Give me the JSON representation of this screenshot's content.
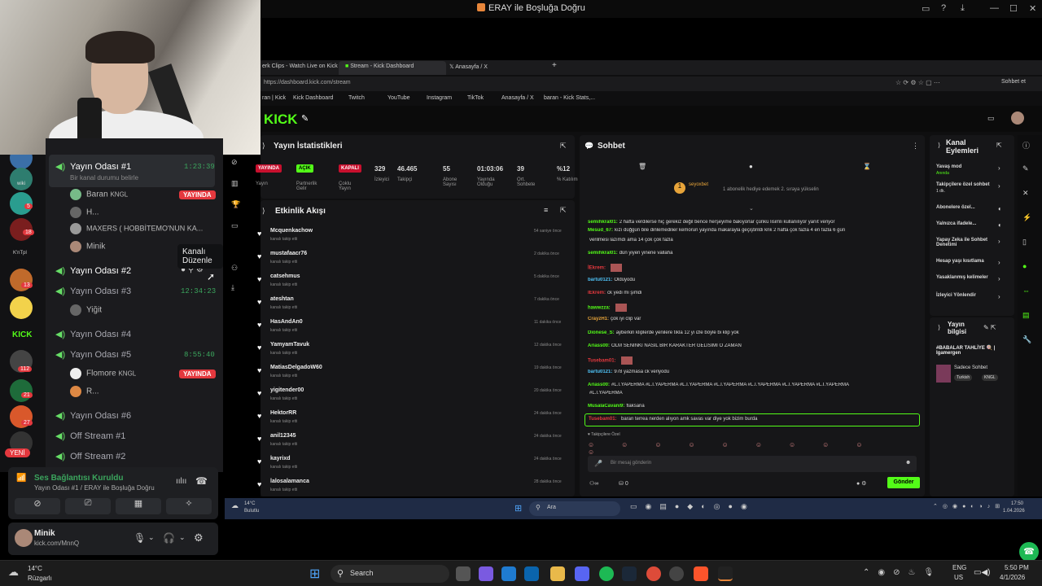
{
  "window": {
    "title": "ERAY ile Boşluğa Doğru"
  },
  "servers": [
    {
      "badge": "2"
    },
    {
      "label": "wiki"
    },
    {
      "badge": "5"
    },
    {
      "badge": "18"
    },
    {
      "label": "K'nTpl"
    },
    {
      "badge": "13"
    },
    {
      "label": ""
    },
    {
      "label": "KICK"
    },
    {
      "badge": "112"
    },
    {
      "badge": "21"
    },
    {
      "badge": "27"
    },
    {
      "badge": ""
    },
    {
      "label": "YENİ"
    }
  ],
  "channels": {
    "items": [
      {
        "name": "Yayın Odası #1",
        "time": "1:23:39",
        "status": "Bir kanal durumu belirle"
      },
      {
        "name": "Yayın Odası #2"
      },
      {
        "name": "Yayın Odası #3",
        "time": "12:34:23"
      },
      {
        "name": "Yayın Odası #4"
      },
      {
        "name": "Yayın Odası #5",
        "time": "8:55:40"
      },
      {
        "name": "Yayın Odası #6"
      },
      {
        "name": "Off Stream #1"
      },
      {
        "name": "Off Stream #2"
      }
    ],
    "users1": [
      {
        "name": "Baran",
        "tag": "KNGL",
        "live": "YAYINDA"
      },
      {
        "name": "H..."
      },
      {
        "name": "MAXERS ( HOBBİTEMO'NUN KA..."
      },
      {
        "name": "Minik"
      }
    ],
    "users3": [
      {
        "name": "Yiğit"
      }
    ],
    "users5": [
      {
        "name": "Flomore",
        "tag": "KNGL",
        "live": "YAYINDA"
      },
      {
        "name": "R..."
      }
    ],
    "tooltip": "Kanalı Düzenle"
  },
  "voice": {
    "title": "Ses Bağlantısı Kuruldu",
    "sub": "Yayın Odası #1 / ERAY ile Boşluğa Doğru"
  },
  "user": {
    "name": "Minik",
    "status": "kick.com/MnnQ"
  },
  "browser": {
    "tabs": [
      "erk Clips - Watch Live on Kick",
      "Stream - Kick Dashboard",
      "Anasayfa / X"
    ],
    "url": "https://dashboard.kick.com/stream",
    "bookmarks": [
      "ran | Kick",
      "Kick Dashboard",
      "Twitch",
      "YouTube",
      "Instagram",
      "TikTok",
      "Anasayfa / X",
      "baran - Kick Stats,..."
    ]
  },
  "kick": {
    "logo": "KICK",
    "stats": {
      "title": "Yayın İstatistikleri",
      "pills": [
        {
          "value": "YAYINDA",
          "label": "Yayın"
        },
        {
          "value": "AÇIK",
          "label": "Partnerlik Gelir"
        },
        {
          "value": "KAPALI",
          "label": "Çoklu Yayın"
        }
      ],
      "items": [
        {
          "value": "329",
          "label": "İzleyici"
        },
        {
          "value": "46.465",
          "label": "Takipçi"
        },
        {
          "value": "55",
          "label": "Abone Sayısı"
        },
        {
          "value": "01:03:06",
          "label": "Yayında Olduğu"
        },
        {
          "value": "39",
          "label": "Ort. Sohbete"
        },
        {
          "value": "%12",
          "label": "% Katılım"
        }
      ]
    },
    "activity": {
      "title": "Etkinlik Akışı",
      "sub": "kanalı takip etti",
      "items": [
        {
          "name": "Mcquenkachow",
          "time": "54 saniye önce"
        },
        {
          "name": "mustafaacr76",
          "time": "2 dakika önce"
        },
        {
          "name": "catsehmus",
          "time": "5 dakika önce"
        },
        {
          "name": "ateshtan",
          "time": "7 dakika önce"
        },
        {
          "name": "HasAndAn0",
          "time": "11 dakika önce"
        },
        {
          "name": "YamyamTavuk",
          "time": "12 dakika önce"
        },
        {
          "name": "MatiasDelgadoW60",
          "time": "19 dakika önce"
        },
        {
          "name": "yigitender00",
          "time": "20 dakika önce"
        },
        {
          "name": "HektorRR",
          "time": "24 dakika önce"
        },
        {
          "name": "anil12345",
          "time": "24 dakika önce"
        },
        {
          "name": "kayrixd",
          "time": "24 dakika önce"
        },
        {
          "name": "lalosalamanca",
          "time": "28 dakika önce"
        }
      ]
    },
    "chat": {
      "title": "Sohbet",
      "pinned_user": "seyoxbet",
      "pinned_text": "1 abonelik hediye edemek 2. sıraya yükselin",
      "lines": [
        {
          "user": "semihkral01:",
          "text": "2 hafta verdilerse hiç gerekiz değil bence herşeyime bakıyorlar çünkü lisimli kullanılıyor yanıt veriyor",
          "c": "nm-g"
        },
        {
          "user": "Mesud_67:",
          "text": "kızı düğgün bile dinlemedilier kemorun yayında makarayla geçiştirildi knk 2 hafta çok fazla 4 en fazla 6 gün",
          "c": "nm-g"
        },
        {
          "user": "",
          "text": "verilmesi lazımdı ama 14 çok çok fazla",
          "c": "nm-g"
        },
        {
          "user": "semihkral01:",
          "text": "dün yiyen yinene vallaha",
          "c": "nm-g"
        },
        {
          "user": "İEkrem:",
          "text": "",
          "c": "nm-r"
        },
        {
          "user": "bartu0121:",
          "text": "Öldüyodu",
          "c": "nm-c"
        },
        {
          "user": "İEkrem:",
          "text": "ck yedi mi şimdi",
          "c": "nm-r"
        },
        {
          "user": "hawwzza:",
          "text": "",
          "c": "nm-g"
        },
        {
          "user": "CrayzH1:",
          "text": "çok iyi clip var",
          "c": "nm-o"
        },
        {
          "user": "Dionese_S:",
          "text": "ayberkin kliplerde yenilere tıkla 12 yi izle böyle bi klip yok",
          "c": "nm-g"
        },
        {
          "user": "Ariass00:",
          "text": "OLM SENİNKİ NASIL BİR KARAKTER GELİSİMİ O ZAMAN",
          "c": "nm-g"
        },
        {
          "user": "Tusebam01:",
          "text": "",
          "c": "nm-r"
        },
        {
          "user": "bartu0121:",
          "text": "978 yazmasa ck veriyodu",
          "c": "nm-c"
        },
        {
          "user": "Ariass00:",
          "text": "#L.İ.YAPERMA #L.İ.YAPERMA #L.İ.YAPERMA #L.İ.YAPERMA #L.İ.YAPERMA #L.İ.YAPERMA #L.İ.YAPERMA",
          "c": "nm-g"
        },
        {
          "user": "",
          "text": "#L.İ.YAPERMA",
          "c": "nm-g"
        },
        {
          "user": "MusalaCavani9:",
          "text": "flaksana",
          "c": "nm-g"
        }
      ],
      "highlight_user": "Tusebam01:",
      "highlight_text": "baran terrea nerden alıyon amk savas var diye yok bizim burda",
      "followers_label": "Takipçilere Özel",
      "placeholder": "Bir mesaj gönderin",
      "count": "0",
      "send": "Gönder"
    },
    "side": {
      "title": "Kanal Eylemleri",
      "items": [
        {
          "label": "Yavaş mod",
          "sub": "Anında"
        },
        {
          "label": "Takipçilere özel sohbet",
          "sub": "1 dk."
        },
        {
          "label": "Abonelere özel...",
          "sub": ""
        },
        {
          "label": "Yalnızca ifadele...",
          "sub": ""
        },
        {
          "label": "Yapay Zeka ile Sohbet Denetimi",
          "sub": ""
        },
        {
          "label": "Hesap yaşı kısıtlama",
          "sub": ""
        },
        {
          "label": "Yasaklanmış kelimeler",
          "sub": ""
        },
        {
          "label": "İzleyici Yönlendir",
          "sub": ""
        }
      ],
      "info_title": "Yayın bilgisi",
      "info_stream": "#BABALAR TAHLİYE 🍭 | Igamergen",
      "info_cat": "Sadece Sohbet",
      "info_tags": [
        "Turkish",
        "KNGL"
      ]
    },
    "chat_top_right": "Sohbet et"
  },
  "inner_taskbar": {
    "weather": "14°C",
    "weather_sub": "Bulutlu",
    "search": "Ara",
    "time": "17:50",
    "date": "1.04.2026"
  },
  "taskbar": {
    "weather": "14°C",
    "weather_sub": "Rüzgarlı",
    "search": "Search",
    "lang": "ENG",
    "lang_sub": "US",
    "time": "5:50 PM",
    "date": "4/1/2026"
  },
  "colors": {
    "kick_green": "#53fc18",
    "live_red": "#e4383e",
    "discord_bg": "#1b1b1e"
  }
}
